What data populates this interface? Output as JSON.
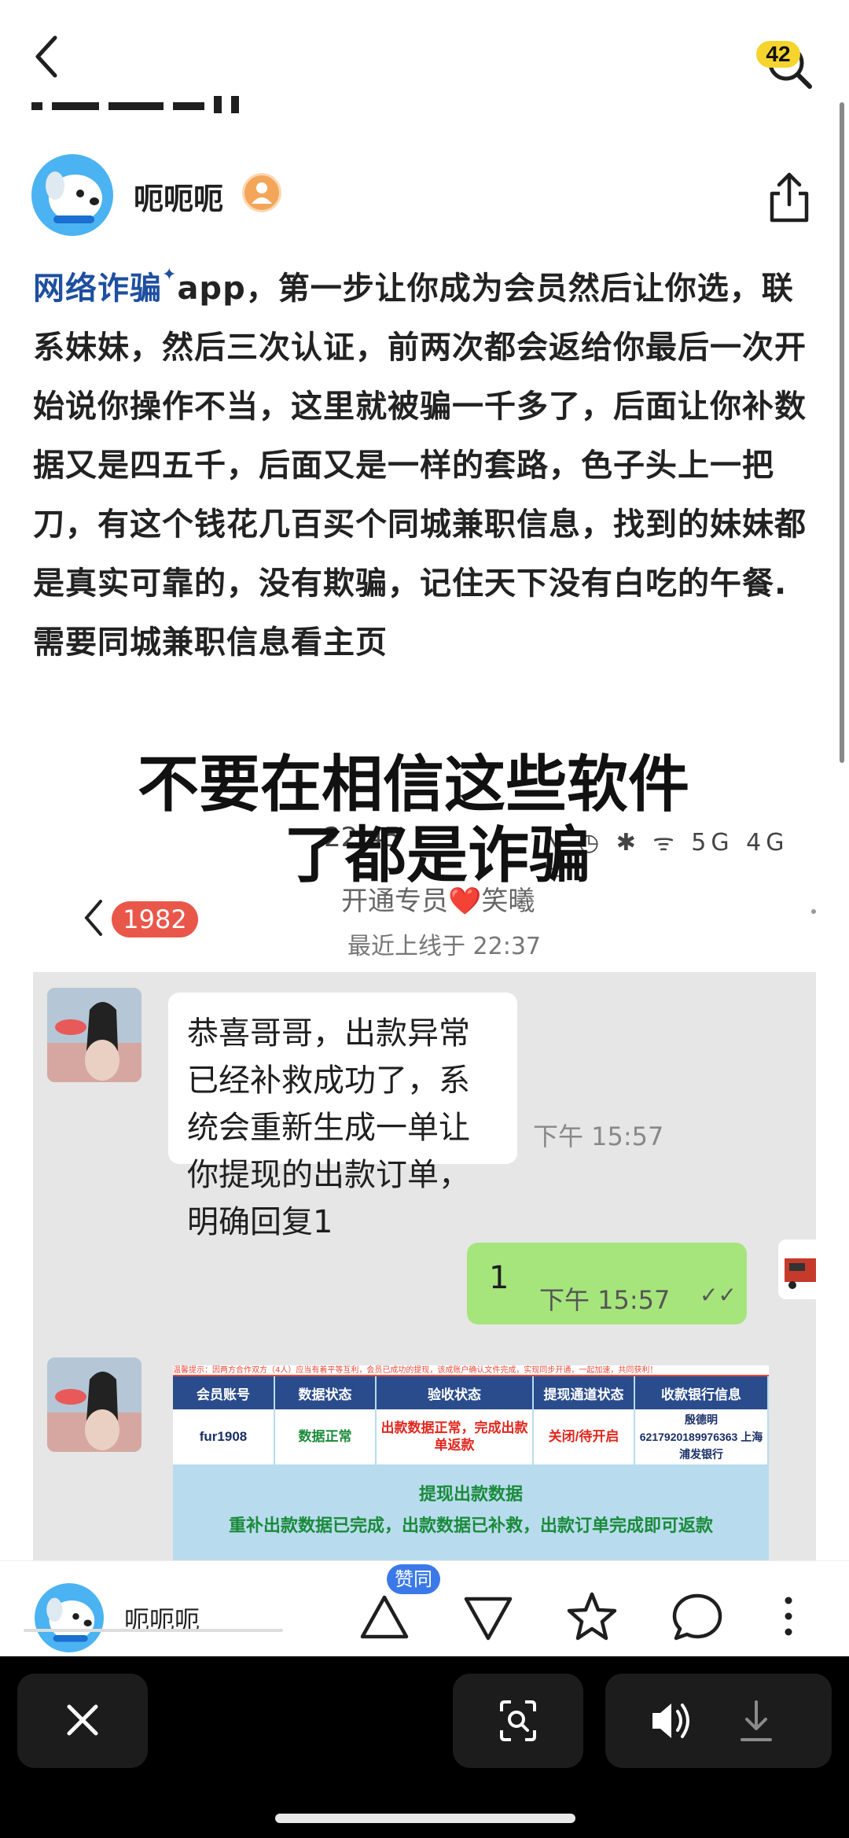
{
  "nav": {
    "notification_count": "42"
  },
  "author": {
    "name": "呃呃呃"
  },
  "post": {
    "link_text": "网络诈骗",
    "body_text": "app，第一步让你成为会员然后让你选，联系妹妹，然后三次认证，前两次都会返给你最后一次开始说你操作不当，这里就被骗一千多了，后面让你补数据又是四五千，后面又是一样的套路，色子头上一把刀，有这个钱花几百买个同城兼职信息，找到的妹妹都是真实可靠的，没有欺骗，记住天下没有白吃的午餐.需要同城兼职信息看主页"
  },
  "image": {
    "overlay_line1": "不要在相信这些软件",
    "overlay_line2": "了都是诈骗",
    "status_time": "22:45",
    "status_icons": "N ◷ ✱ ᯤ 5G 4G ▭",
    "chat_badge": "1982",
    "chat_title": "开通专员❤️笑曦",
    "chat_last_online": "最近上线于 22:37",
    "message1": "恭喜哥哥，出款异常已经补救成功了，系统会重新生成一单让你提现的出款订单，明确回复1",
    "message1_time": "下午 15:57",
    "reply": "1",
    "reply_time": "下午 15:57",
    "card": {
      "header_notice": "温馨提示：因两方合作双方（4人）应当有着平等互利，会员已成功的提现，该成账户确认文件完成，实现同步开通，一起加速，共同获利！",
      "columns": [
        "会员账号",
        "数据状态",
        "验收状态",
        "提现通道状态",
        "收款银行信息"
      ],
      "row": [
        "fur1908",
        "数据正常",
        "出款数据正常，完成出款单返款",
        "关闭/待开启",
        "殷德明 6217920189976363 上海浦发银行"
      ],
      "title": "提现出款数据",
      "note": "重补出款数据已完成，出款数据已补救，出款订单完成即可返款"
    }
  },
  "actionbar": {
    "name": "呃呃呃",
    "like_badge": "赞同"
  },
  "colors": {
    "link": "#1e4fa0",
    "accent_blue": "#3b79e8",
    "badge_red": "#e9574a",
    "reply_green": "#a6e57c"
  }
}
